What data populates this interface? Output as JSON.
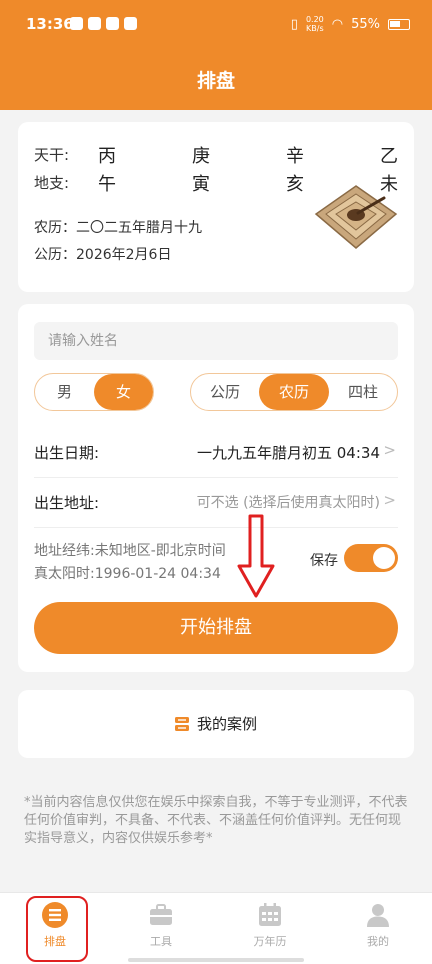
{
  "status": {
    "time": "13:36",
    "net_speed_value": "0.20",
    "net_speed_unit": "KB/s",
    "battery": "55%"
  },
  "header": {
    "title": "排盘"
  },
  "ganzhi": {
    "tiangan_label": "天干:",
    "dizhi_label": "地支:",
    "tiangan": [
      "丙",
      "庚",
      "辛",
      "乙"
    ],
    "dizhi": [
      "午",
      "寅",
      "亥",
      "未"
    ]
  },
  "dates": {
    "lunar": "农历：二〇二五年腊月十九",
    "solar": "公历：2026年2月6日"
  },
  "form": {
    "name_placeholder": "请输入姓名",
    "gender": {
      "male": "男",
      "female": "女",
      "selected": "女"
    },
    "calendar": {
      "solar": "公历",
      "lunar": "农历",
      "pillars": "四柱",
      "selected": "农历"
    },
    "birth_date_label": "出生日期:",
    "birth_date_value": "一九九五年腊月初五 04:34",
    "birth_place_label": "出生地址:",
    "birth_place_value": "可不选 (选择后使用真太阳时)",
    "coords_info": "地址经纬:未知地区-即北京时间",
    "solar_time_info": "真太阳时:1996-01-24 04:34",
    "save_label": "保存",
    "save_on": true,
    "start_button": "开始排盘"
  },
  "cases": {
    "label": "我的案例"
  },
  "disclaimer": "*当前内容信息仅供您在娱乐中探索自我，不等于专业测评，不代表任何价值审判，不具备、不代表、不涵盖任何价值评判。无任何现实指导意义，内容仅供娱乐参考*",
  "tabs": [
    {
      "label": "排盘",
      "icon": "paipan-icon",
      "active": true
    },
    {
      "label": "工具",
      "icon": "toolbox-icon",
      "active": false
    },
    {
      "label": "万年历",
      "icon": "calendar-icon",
      "active": false
    },
    {
      "label": "我的",
      "icon": "profile-icon",
      "active": false
    }
  ],
  "colors": {
    "accent": "#ef8a2a",
    "highlight": "#e02020"
  }
}
